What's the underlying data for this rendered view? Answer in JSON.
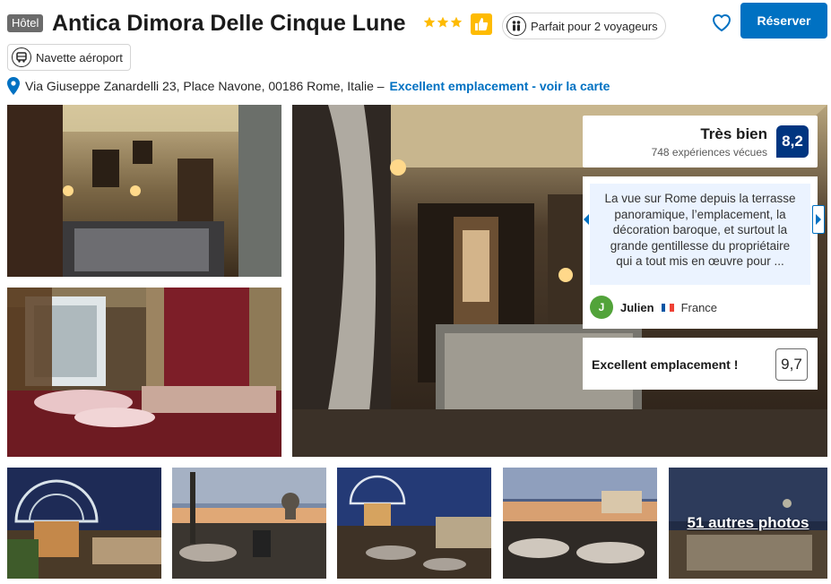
{
  "property": {
    "type_badge": "Hôtel",
    "name": "Antica Dimora Delle Cinque Lune",
    "star_count": 3,
    "travelers_label": "Parfait pour 2 voyageurs",
    "shuttle_label": "Navette aéroport"
  },
  "actions": {
    "reserve_label": "Réserver"
  },
  "address": {
    "text": "Via Giuseppe Zanardelli 23, Place Navone, 00186 Rome, Italie –",
    "link": "Excellent emplacement - voir la carte"
  },
  "rating": {
    "label": "Très bien",
    "count": "748 expériences vécues",
    "score": "8,2"
  },
  "review": {
    "lines": [
      "La vue sur Rome depuis la terrasse",
      "panoramique, l’emplacement, la",
      "décoration baroque, et surtout la",
      "grande gentillesse du propriétaire",
      "qui a tout mis en œuvre pour ..."
    ],
    "avatar_initial": "J",
    "author": "Julien",
    "country": "France"
  },
  "location_score": {
    "label": "Excellent emplacement !",
    "score": "9,7"
  },
  "gallery": {
    "more_photos": "51 autres photos"
  },
  "colors": {
    "brand_blue": "#0071c2",
    "score_navy": "#003580",
    "star_yellow": "#febb02",
    "avatar_green": "#52a33a"
  },
  "icons": [
    "thumbs-up-icon",
    "travelers-icon",
    "shuttle-icon",
    "heart-icon",
    "location-pin-icon",
    "chevron-left-icon",
    "chevron-right-icon",
    "star-icon"
  ]
}
